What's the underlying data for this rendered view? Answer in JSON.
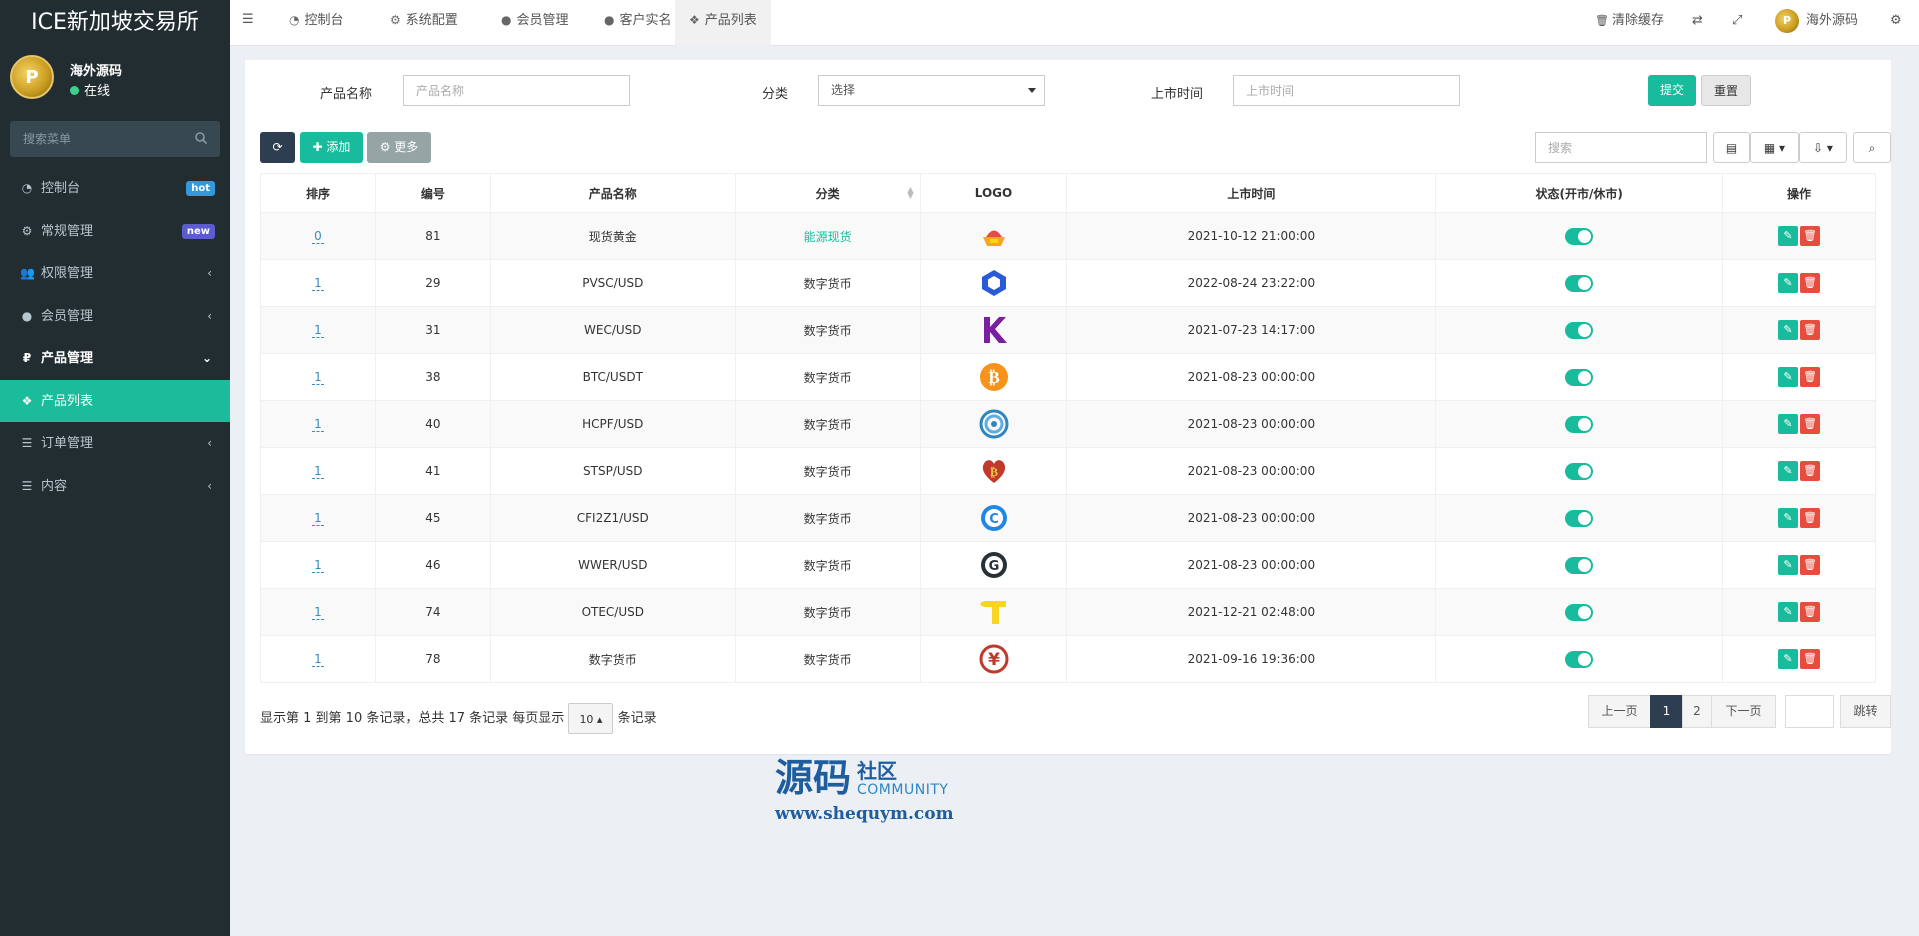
{
  "app": {
    "title": "ICE新加坡交易所"
  },
  "user": {
    "name": "海外源码",
    "status": "在线",
    "avatar_letter": "P"
  },
  "sidebar": {
    "search_placeholder": "搜索菜单",
    "items": [
      {
        "label": "控制台",
        "icon": "dashboard-icon",
        "badge": "hot"
      },
      {
        "label": "常规管理",
        "icon": "cogs-icon",
        "badge": "new"
      },
      {
        "label": "权限管理",
        "icon": "group-icon",
        "chevron": "‹"
      },
      {
        "label": "会员管理",
        "icon": "user-circle-icon",
        "chevron": "‹"
      },
      {
        "label": "产品管理",
        "icon": "product-icon",
        "chevron": "⌄"
      },
      {
        "label": "产品列表",
        "icon": "cubes-icon"
      },
      {
        "label": "订单管理",
        "icon": "list-icon",
        "chevron": "‹"
      },
      {
        "label": "内容",
        "icon": "list-icon",
        "chevron": "‹"
      }
    ]
  },
  "topbar": {
    "tabs": [
      {
        "label": "控制台"
      },
      {
        "label": "系统配置"
      },
      {
        "label": "会员管理"
      },
      {
        "label": "客户实名"
      },
      {
        "label": "产品列表"
      }
    ],
    "clear_cache": "清除缓存",
    "user_name": "海外源码"
  },
  "filter": {
    "name_label": "产品名称",
    "name_placeholder": "产品名称",
    "category_label": "分类",
    "category_value": "选择",
    "date_label": "上市时间",
    "date_placeholder": "上市时间",
    "submit": "提交",
    "reset": "重置"
  },
  "toolbar": {
    "add": "添加",
    "more": "更多",
    "search_placeholder": "搜索"
  },
  "table": {
    "headers": [
      "排序",
      "编号",
      "产品名称",
      "分类",
      "LOGO",
      "上市时间",
      "状态(开市/休市)",
      "操作"
    ],
    "rows": [
      {
        "sort": "0",
        "id": "81",
        "name": "现货黄金",
        "category": "能源现货",
        "logo": "gold-logo",
        "date": "2021-10-12 21:00:00",
        "status": true
      },
      {
        "sort": "1",
        "id": "29",
        "name": "PVSC/USD",
        "category": "数字货币",
        "logo": "hexagon-logo",
        "date": "2022-08-24 23:22:00",
        "status": true
      },
      {
        "sort": "1",
        "id": "31",
        "name": "WEC/USD",
        "category": "数字货币",
        "logo": "k-logo",
        "date": "2021-07-23 14:17:00",
        "status": true
      },
      {
        "sort": "1",
        "id": "38",
        "name": "BTC/USDT",
        "category": "数字货币",
        "logo": "bitcoin-logo",
        "date": "2021-08-23 00:00:00",
        "status": true
      },
      {
        "sort": "1",
        "id": "40",
        "name": "HCPF/USD",
        "category": "数字货币",
        "logo": "flower-logo",
        "date": "2021-08-23 00:00:00",
        "status": true
      },
      {
        "sort": "1",
        "id": "41",
        "name": "STSP/USD",
        "category": "数字货币",
        "logo": "heart-bitcoin-logo",
        "date": "2021-08-23 00:00:00",
        "status": true
      },
      {
        "sort": "1",
        "id": "45",
        "name": "CFI2Z1/USD",
        "category": "数字货币",
        "logo": "c-coin-logo",
        "date": "2021-08-23 00:00:00",
        "status": true
      },
      {
        "sort": "1",
        "id": "46",
        "name": "WWER/USD",
        "category": "数字货币",
        "logo": "g-logo",
        "date": "2021-08-23 00:00:00",
        "status": true
      },
      {
        "sort": "1",
        "id": "74",
        "name": "OTEC/USD",
        "category": "数字货币",
        "logo": "t-logo",
        "date": "2021-12-21 02:48:00",
        "status": true
      },
      {
        "sort": "1",
        "id": "78",
        "name": "数字货币",
        "category": "数字货币",
        "logo": "yuan-logo",
        "date": "2021-09-16 19:36:00",
        "status": true
      }
    ]
  },
  "pagination": {
    "info": "显示第 1 到第 10 条记录，总共 17 条记录 每页显示",
    "page_size": "10",
    "suffix": "条记录",
    "prev": "上一页",
    "pages": [
      "1",
      "2"
    ],
    "next": "下一页",
    "jump": "跳转"
  },
  "watermark": {
    "main": "源码",
    "sub1": "社区",
    "sub2": "COMMUNITY",
    "url": "www.shequym.com"
  },
  "colors": {
    "accent": "#18bc9c",
    "sidebar": "#222d32",
    "danger": "#e74c3c",
    "primary_dark": "#2c3e50"
  }
}
